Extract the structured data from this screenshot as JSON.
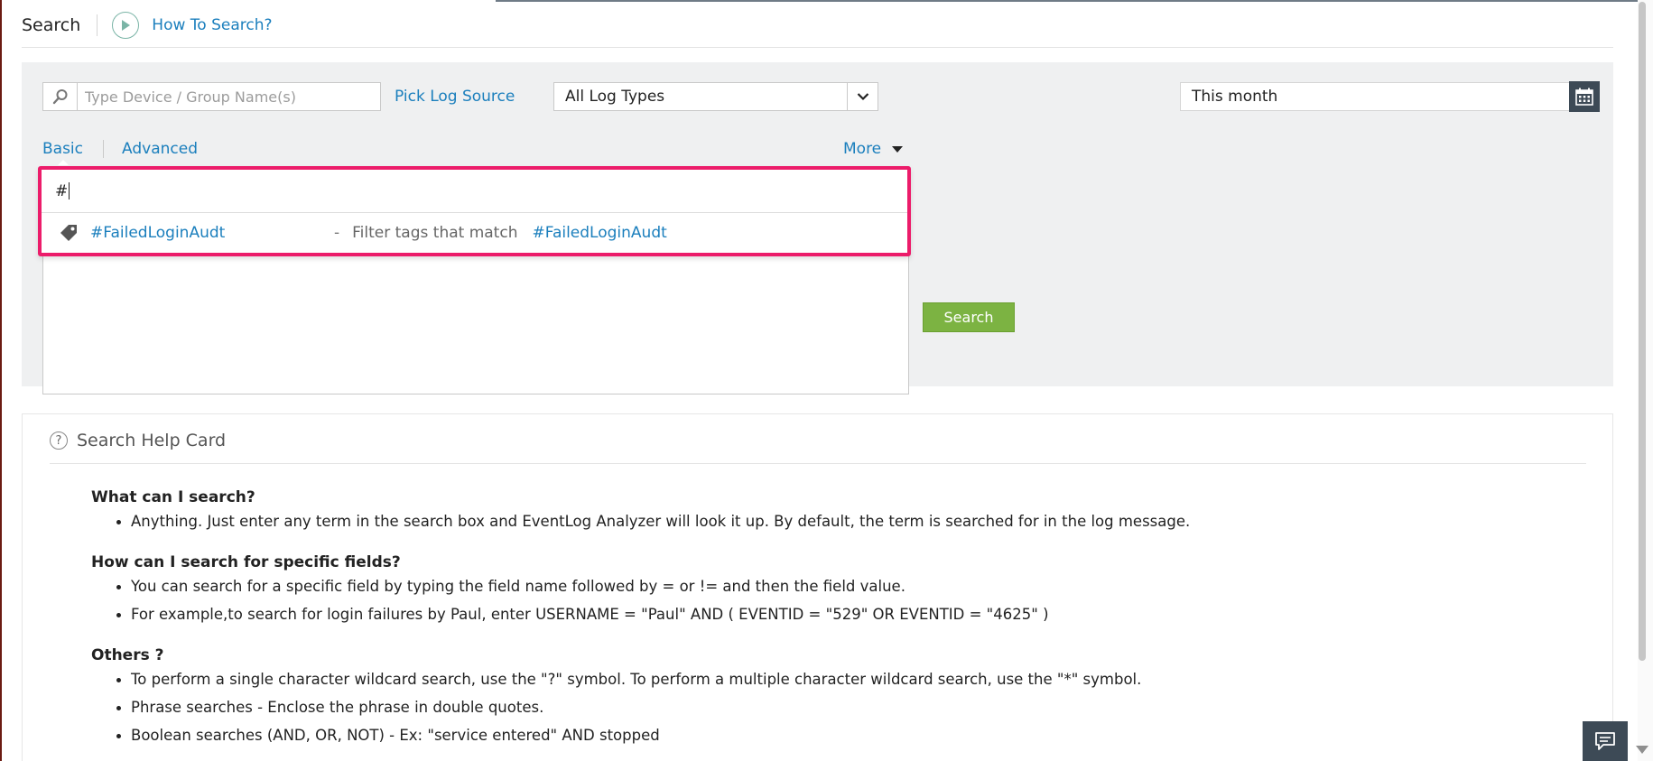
{
  "header": {
    "title": "Search",
    "howto_label": "How To Search?"
  },
  "filters": {
    "device_placeholder": "Type Device / Group Name(s)",
    "pick_log_source": "Pick Log Source",
    "log_type_selected": "All Log Types",
    "date_range": "This month"
  },
  "modes": {
    "basic": "Basic",
    "advanced": "Advanced",
    "more": "More"
  },
  "query": {
    "text": "#"
  },
  "suggestion": {
    "tag": "#FailedLoginAudt",
    "dash": "-",
    "description": "Filter tags that match",
    "match": "#FailedLoginAudt"
  },
  "search_button": "Search",
  "help": {
    "title": "Search Help Card",
    "sections": [
      {
        "question": "What can I search?",
        "items": [
          "Anything. Just enter any term in the search box and EventLog Analyzer will look it up. By default, the term is searched for in the log message."
        ]
      },
      {
        "question": "How can I search for specific fields?",
        "items": [
          "You can search for a specific field by typing the field name followed by = or != and then the field value.",
          "For example,to search for login failures by Paul, enter USERNAME = \"Paul\" AND ( EVENTID = \"529\" OR EVENTID = \"4625\" )"
        ]
      },
      {
        "question": "Others ?",
        "items": [
          "To perform a single character wildcard search, use the \"?\" symbol. To perform a multiple character wildcard search, use the \"*\" symbol.",
          "Phrase searches - Enclose the phrase in double quotes.",
          "Boolean searches (AND, OR, NOT) - Ex: \"service entered\" AND stopped"
        ]
      }
    ]
  },
  "colors": {
    "link": "#1b7fbd",
    "highlight_border": "#ec1c6a",
    "search_button": "#7cb342",
    "panel_bg": "#eff0f1",
    "dark_button": "#3d4a56"
  }
}
